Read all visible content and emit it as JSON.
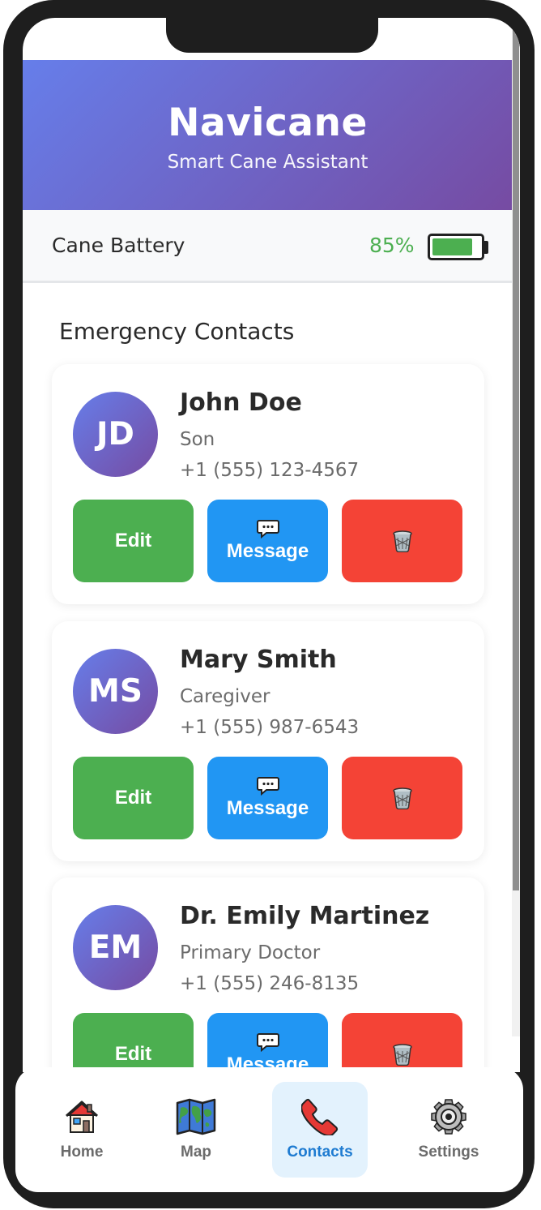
{
  "header": {
    "title": "Navicane",
    "subtitle": "Smart Cane Assistant"
  },
  "battery": {
    "label": "Cane Battery",
    "percent_text": "85%",
    "level": 0.85,
    "color": "#4caf50"
  },
  "contacts_section": {
    "title": "Emergency Contacts",
    "contacts": [
      {
        "initials": "JD",
        "name": "John Doe",
        "relation": "Son",
        "phone": "+1 (555) 123-4567",
        "edit_label": "Edit",
        "message_label": "Message",
        "delete_icon": "trash-icon"
      },
      {
        "initials": "MS",
        "name": "Mary Smith",
        "relation": "Caregiver",
        "phone": "+1 (555) 987-6543",
        "edit_label": "Edit",
        "message_label": "Message",
        "delete_icon": "trash-icon"
      },
      {
        "initials": "EM",
        "name": "Dr. Emily Martinez",
        "relation": "Primary Doctor",
        "phone": "+1 (555) 246-8135",
        "edit_label": "Edit",
        "message_label": "Message",
        "delete_icon": "trash-icon"
      }
    ]
  },
  "bottom_nav": {
    "items": [
      {
        "label": "Home",
        "icon": "house-icon",
        "active": false
      },
      {
        "label": "Map",
        "icon": "world-map-icon",
        "active": false
      },
      {
        "label": "Contacts",
        "icon": "telephone-icon",
        "active": true
      },
      {
        "label": "Settings",
        "icon": "gear-icon",
        "active": false
      }
    ]
  },
  "colors": {
    "header_gradient_start": "#667eea",
    "header_gradient_end": "#764ba2",
    "edit_button": "#4caf50",
    "message_button": "#2196f3",
    "delete_button": "#f44336",
    "active_nav_bg": "#e3f2fd",
    "active_nav_text": "#1e7bd1"
  }
}
